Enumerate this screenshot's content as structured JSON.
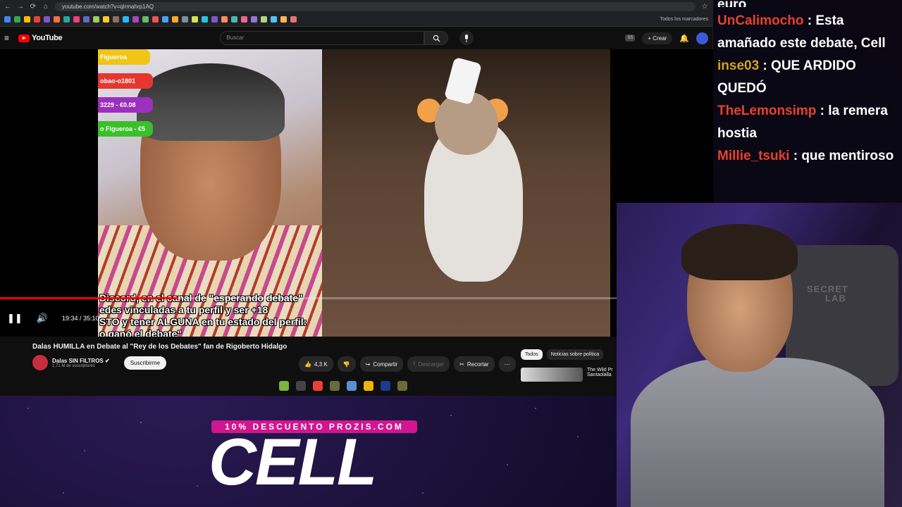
{
  "browser": {
    "url": "youtube.com/watch?v=qIrmahrp1AQ",
    "bookmarks_folder": "Todos los marcadores",
    "bookmark_colors": [
      "#4285f4",
      "#34a853",
      "#fbbc05",
      "#ea4335",
      "#7e57c2",
      "#ff7043",
      "#26a69a",
      "#ec407a",
      "#5c6bc0",
      "#9ccc65",
      "#ffca28",
      "#8d6e63",
      "#29b6f6",
      "#ab47bc",
      "#66bb6a",
      "#ef5350",
      "#42a5f5",
      "#ffa726",
      "#78909c",
      "#d4e157",
      "#26c6da",
      "#7e57c2",
      "#ff8a65",
      "#4db6ac",
      "#f06292",
      "#9575cd",
      "#aed581",
      "#4fc3f7",
      "#ffb74d",
      "#e57373"
    ]
  },
  "youtube": {
    "logo": "YouTube",
    "search_placeholder": "Buscar",
    "ss_badge": "SS",
    "create_label": "Crear"
  },
  "video": {
    "labels": [
      {
        "text": "Figueroa",
        "color": "#f0c419"
      },
      {
        "text": "obao-o1801",
        "color": "#e5372f"
      },
      {
        "text": "3229 - €0.08",
        "color": "#9b2fbf"
      },
      {
        "text": "o Figueroa - €5",
        "color": "#3bbf2a"
      }
    ],
    "subtitles": [
      "Discord, en el canal de \"esperando debate\"",
      "edes vinculadas a tu perfil y ser +18",
      "STO y tener ALGUNA en tu estado del perfil:",
      "o ganó el debate\""
    ],
    "time": "19:34 / 35:10",
    "progress": 0.556
  },
  "info": {
    "title": "Dalas HUMILLA en Debate al \"Rey de los Debates\" fan de Rigoberto Hidalgo",
    "channel_name": "Dalas SIN FILTROS",
    "subscribers": "1,71 M de suscriptores",
    "subscribe_label": "Suscribirme",
    "likes": "4,3 K",
    "share_label": "Compartir",
    "download_label": "Descargar",
    "clip_label": "Recortar",
    "chips": [
      "Todos",
      "Noticias sobre política"
    ],
    "related_title": "The Wild Pr Santaolalla"
  },
  "chat": {
    "cut_text": "euro",
    "messages": [
      {
        "user": "UnCalimocho",
        "color": "#e8412c",
        "text": "Esta amañado este debate, Cell"
      },
      {
        "user": "inse03",
        "color": "#d6a21c",
        "text": "QUE ARDIDO QUEDÓ"
      },
      {
        "user": "TheLemonsimp",
        "color": "#e8412c",
        "text": "la remera hostia"
      },
      {
        "user": "Millie_tsuki",
        "color": "#e8412c",
        "text": "que mentiroso"
      }
    ]
  },
  "webcam": {
    "chair_logo_line1": "SECRET",
    "chair_logo_line2": "LAB"
  },
  "promo": {
    "tag": "10% DESCUENTO PROZIS.COM",
    "big": "CELL"
  },
  "taskbar_colors": [
    "#7cb342",
    "#444",
    "#e94235",
    "#6b6b3a",
    "#5b8fd0",
    "#f0b400",
    "#1e3a8a",
    "#6b6b3a"
  ]
}
